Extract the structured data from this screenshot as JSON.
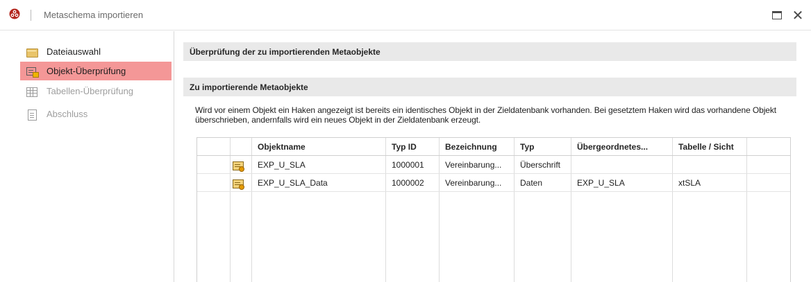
{
  "window": {
    "title": "Metaschema importieren"
  },
  "colors": {
    "active_nav": "#f49797",
    "section_bg": "#e9e9e9",
    "app_icon": "#c0392b"
  },
  "sidebar": {
    "items": [
      {
        "label": "Dateiauswahl",
        "icon": "folder-icon",
        "state": "enabled"
      },
      {
        "label": "Objekt-Überprüfung",
        "icon": "checklist-icon",
        "state": "active"
      },
      {
        "label": "Tabellen-Überprüfung",
        "icon": "table-icon",
        "state": "disabled"
      },
      {
        "label": "Abschluss",
        "icon": "document-icon",
        "state": "disabled"
      }
    ]
  },
  "main": {
    "header": "Überprüfung der zu importierenden Metaobjekte",
    "section_title": "Zu importierende Metaobjekte",
    "description": "Wird vor einem Objekt ein Haken angezeigt ist bereits ein identisches Objekt in der Zieldatenbank vorhanden. Bei gesetztem Haken wird das vorhandene Objekt überschrieben, andernfalls wird ein neues Objekt in der Zieldatenbank erzeugt.",
    "grid": {
      "columns": [
        "",
        "",
        "Objektname",
        "Typ ID",
        "Bezeichnung",
        "Typ",
        "Übergeordnetes...",
        "Tabelle / Sicht",
        ""
      ],
      "rows": [
        {
          "icon": "object-icon",
          "name": "EXP_U_SLA",
          "type_id": "1000001",
          "bezeichnung": "Vereinbarung...",
          "typ": "Überschrift",
          "parent": "",
          "table": ""
        },
        {
          "icon": "object-icon",
          "name": "EXP_U_SLA_Data",
          "type_id": "1000002",
          "bezeichnung": "Vereinbarung...",
          "typ": "Daten",
          "parent": "EXP_U_SLA",
          "table": "xtSLA"
        }
      ]
    }
  }
}
